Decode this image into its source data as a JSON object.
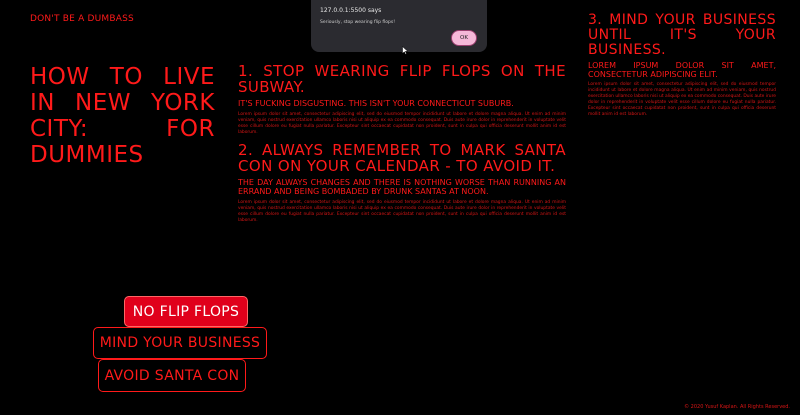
{
  "header": {
    "brand": "DON'T BE A DUMBASS"
  },
  "hero": {
    "title": "HOW TO LIVE IN NEW YORK CITY: FOR DUMMIES"
  },
  "sections": [
    {
      "heading": "1. STOP WEARING FLIP FLOPS ON THE SUBWAY.",
      "subheading": "IT'S FUCKING DISGUSTING. THIS ISN'T YOUR CONNECTICUT SUBURB.",
      "body": "Lorem ipsum dolor sit amet, consectetur adipiscing elit, sed do eiusmod tempor incididunt ut labore et dolore magna aliqua. Ut enim ad minim veniam, quis nostrud exercitation ullamco laboris nisi ut aliquip ex ea commodo consequat. Duis aute irure dolor in reprehenderit in voluptate velit esse cillum dolore eu fugiat nulla pariatur. Excepteur sint occaecat cupidatat non proident, sunt in culpa qui officia deserunt mollit anim id est laborum."
    },
    {
      "heading": "2. ALWAYS REMEMBER TO MARK SANTA CON ON YOUR CALENDAR - TO AVOID IT.",
      "subheading": "THE DAY ALWAYS CHANGES AND THERE IS NOTHING WORSE THAN RUNNING AN ERRAND AND BEING BOMBADED BY DRUNK SANTAS AT NOON.",
      "body": "Lorem ipsum dolor sit amet, consectetur adipiscing elit, sed do eiusmod tempor incididunt ut labore et dolore magna aliqua. Ut enim ad minim veniam, quis nostrud exercitation ullamco laboris nisi ut aliquip ex ea commodo consequat. Duis aute irure dolor in reprehenderit in voluptate velit esse cillum dolore eu fugiat nulla pariatur. Excepteur sint occaecat cupidatat non proident, sunt in culpa qui officia deserunt mollit anim id est laborum."
    },
    {
      "heading": "3. MIND YOUR BUSINESS UNTIL IT'S YOUR BUSINESS.",
      "subheading": "LOREM IPSUM DOLOR SIT AMET, CONSECTETUR ADIPISCING ELIT.",
      "body": "Lorem ipsum dolor sit amet, consectetur adipiscing elit, sed do eiusmod tempor incididunt ut labore et dolore magna aliqua. Ut enim ad minim veniam, quis nostrud exercitation ullamco laboris nisi ut aliquip ex ea commodo consequat. Duis aute irure dolor in reprehenderit in voluptate velit esse cillum dolore eu fugiat nulla pariatur. Excepteur sint occaecat cupidatat non proident, sunt in culpa qui officia deserunt mollit anim id est laborum."
    }
  ],
  "buttons": {
    "flip_flops": "NO FLIP FLOPS",
    "business": "MIND YOUR BUSINESS",
    "santa": "AVOID SANTA CON"
  },
  "footer": {
    "text": "© 2020 Yusuf Kaplan. All Rights Reserved."
  },
  "dialog": {
    "title": "127.0.0.1:5500 says",
    "message": "Seriously, stop wearing flip flops!",
    "ok_label": "OK"
  },
  "colors": {
    "accent": "#ff1a1a",
    "active_button": "#e0001b",
    "background": "#000000",
    "dialog_bg": "#2b2b30",
    "ok_button": "#f5b8d8"
  }
}
